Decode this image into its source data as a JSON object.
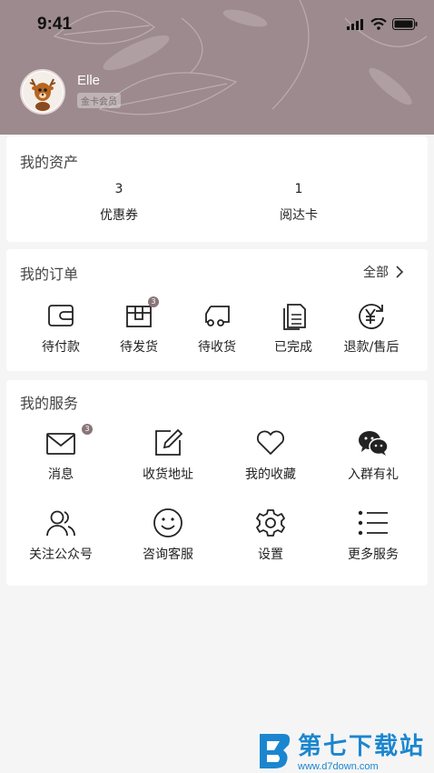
{
  "status_bar": {
    "time": "9:41"
  },
  "user": {
    "name": "Elle",
    "level": "金卡会员"
  },
  "assets": {
    "title": "我的资产",
    "items": [
      {
        "value": "3",
        "label": "优惠券"
      },
      {
        "value": "1",
        "label": "阅达卡"
      }
    ]
  },
  "orders": {
    "title": "我的订单",
    "all_label": "全部",
    "items": [
      {
        "label": "待付款",
        "icon": "wallet-icon",
        "badge": ""
      },
      {
        "label": "待发货",
        "icon": "package-icon",
        "badge": "3"
      },
      {
        "label": "待收货",
        "icon": "truck-icon",
        "badge": ""
      },
      {
        "label": "已完成",
        "icon": "document-icon",
        "badge": ""
      },
      {
        "label": "退款/售后",
        "icon": "refund-icon",
        "badge": ""
      }
    ]
  },
  "services": {
    "title": "我的服务",
    "items": [
      {
        "label": "消息",
        "icon": "mail-icon",
        "badge": "3"
      },
      {
        "label": "收货地址",
        "icon": "edit-icon",
        "badge": ""
      },
      {
        "label": "我的收藏",
        "icon": "heart-icon",
        "badge": ""
      },
      {
        "label": "入群有礼",
        "icon": "wechat-icon",
        "badge": ""
      },
      {
        "label": "关注公众号",
        "icon": "users-icon",
        "badge": ""
      },
      {
        "label": "咨询客服",
        "icon": "smile-icon",
        "badge": ""
      },
      {
        "label": "设置",
        "icon": "gear-icon",
        "badge": ""
      },
      {
        "label": "更多服务",
        "icon": "list-icon",
        "badge": ""
      }
    ]
  },
  "watermark": {
    "main": "第七下载站",
    "sub": "www.d7down.com"
  },
  "colors": {
    "header": "#9c8a8e",
    "badge": "#8a7579",
    "watermark": "#1b86cf"
  }
}
